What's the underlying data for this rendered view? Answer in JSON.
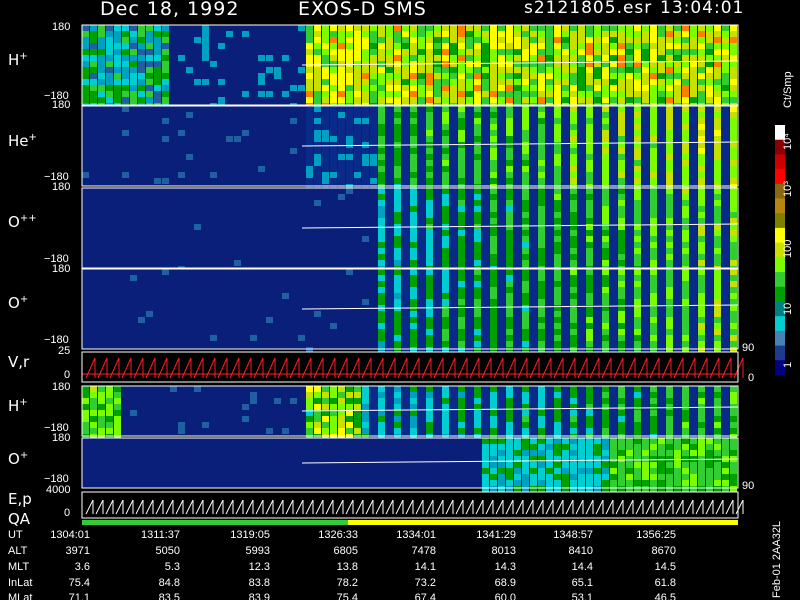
{
  "header": {
    "date": "Dec 18, 1992",
    "instrument": "EXOS-D SMS",
    "file": "s2121805.esr",
    "time": "13:04:01"
  },
  "panels": [
    {
      "label": "H",
      "sup": "+",
      "top_tick": "180",
      "bottom_tick": "−180"
    },
    {
      "label": "He",
      "sup": "+",
      "top_tick": "180",
      "bottom_tick": "−180"
    },
    {
      "label": "O",
      "sup": "++",
      "top_tick": "180",
      "bottom_tick": "−180"
    },
    {
      "label": "O",
      "sup": "+",
      "top_tick": "180",
      "bottom_tick": "−180"
    },
    {
      "label": "V,r",
      "sup": "",
      "top_tick": "25",
      "bottom_tick": "0",
      "right_tick_top": "90",
      "right_tick_bottom": "0"
    },
    {
      "label": "H",
      "sup": "+",
      "top_tick": "180",
      "bottom_tick": "−180"
    },
    {
      "label": "O",
      "sup": "+",
      "top_tick": "180",
      "bottom_tick": "−180",
      "right_tick_bottom": "90"
    },
    {
      "label": "E,p",
      "sup": "",
      "top_tick": "4000",
      "bottom_tick": "0"
    },
    {
      "label": "QA",
      "sup": ""
    }
  ],
  "colorbar": {
    "unit": "Ct/Smp",
    "labels": [
      "10⁴",
      "10³",
      "100",
      "10",
      "1"
    ],
    "colors": [
      "#ffffff",
      "#8b0000",
      "#cc0000",
      "#ff0000",
      "#8b6914",
      "#b8860b",
      "#808000",
      "#ffff00",
      "#c8e000",
      "#7cfc00",
      "#32cd32",
      "#00a000",
      "#008080",
      "#00ced1",
      "#4682b4",
      "#1e3a8a",
      "#000080"
    ]
  },
  "footer": {
    "row_labels": [
      "UT",
      "ALT",
      "MLT",
      "InLat",
      "MLat"
    ],
    "columns": [
      [
        "1304:01",
        "3971",
        "3.6",
        "75.4",
        "71.1"
      ],
      [
        "1311:37",
        "5050",
        "5.3",
        "84.8",
        "83.5"
      ],
      [
        "1319:05",
        "5993",
        "12.3",
        "83.8",
        "83.9"
      ],
      [
        "1326:33",
        "6805",
        "13.8",
        "78.2",
        "75.4"
      ],
      [
        "1334:01",
        "7478",
        "14.1",
        "73.2",
        "67.4"
      ],
      [
        "1341:29",
        "8013",
        "14.3",
        "68.9",
        "60.0"
      ],
      [
        "1348:57",
        "8410",
        "14.4",
        "65.1",
        "53.1"
      ],
      [
        "1356:25",
        "8670",
        "14.5",
        "61.8",
        "46.5"
      ]
    ],
    "side_note": "Feb-01 2AA32L"
  }
}
